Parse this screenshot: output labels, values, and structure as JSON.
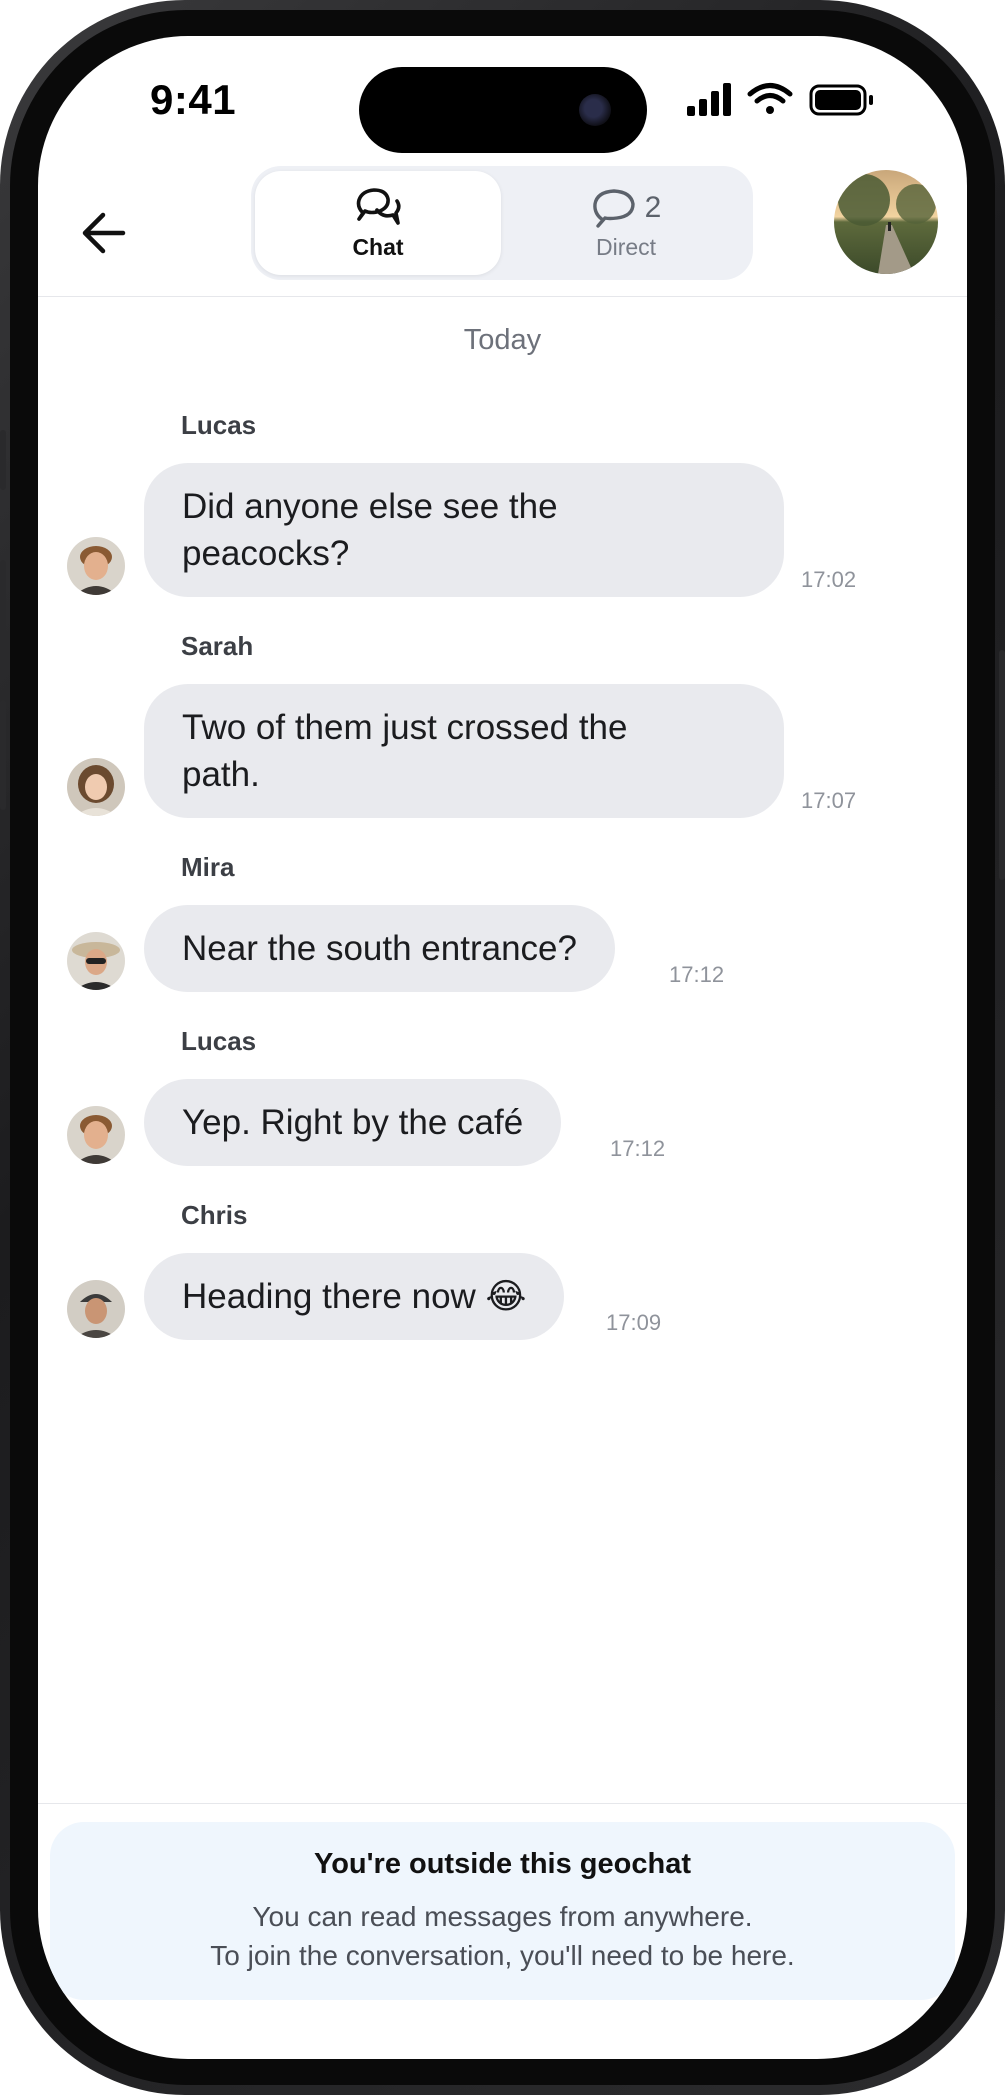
{
  "status_bar": {
    "time": "9:41"
  },
  "header": {
    "tabs": [
      {
        "label": "Chat",
        "icon": "chat-bubbles-icon",
        "active": true
      },
      {
        "label": "Direct",
        "icon": "speech-bubble-icon",
        "badge": "2",
        "active": false
      }
    ]
  },
  "date_separator": "Today",
  "messages": [
    {
      "sender": "Lucas",
      "lines": [
        "Did anyone else see the",
        "peacocks?"
      ],
      "time": "17:02"
    },
    {
      "sender": "Sarah",
      "lines": [
        "Two of them just crossed the",
        "path."
      ],
      "time": "17:07"
    },
    {
      "sender": "Mira",
      "lines": [
        "Near the south entrance?"
      ],
      "time": "17:12"
    },
    {
      "sender": "Lucas",
      "lines": [
        "Yep. Right by the café"
      ],
      "time": "17:12"
    },
    {
      "sender": "Chris",
      "lines": [
        "Heading there now 😂"
      ],
      "time": "17:09"
    }
  ],
  "notice": {
    "title": "You're outside this geochat",
    "line1": "You can read messages from anywhere.",
    "line2": "To join the conversation, you'll need to be here."
  },
  "colors": {
    "bubble": "#e9eaee",
    "notice_bg": "#eff6fd",
    "segment_bg": "#eef0f5"
  }
}
